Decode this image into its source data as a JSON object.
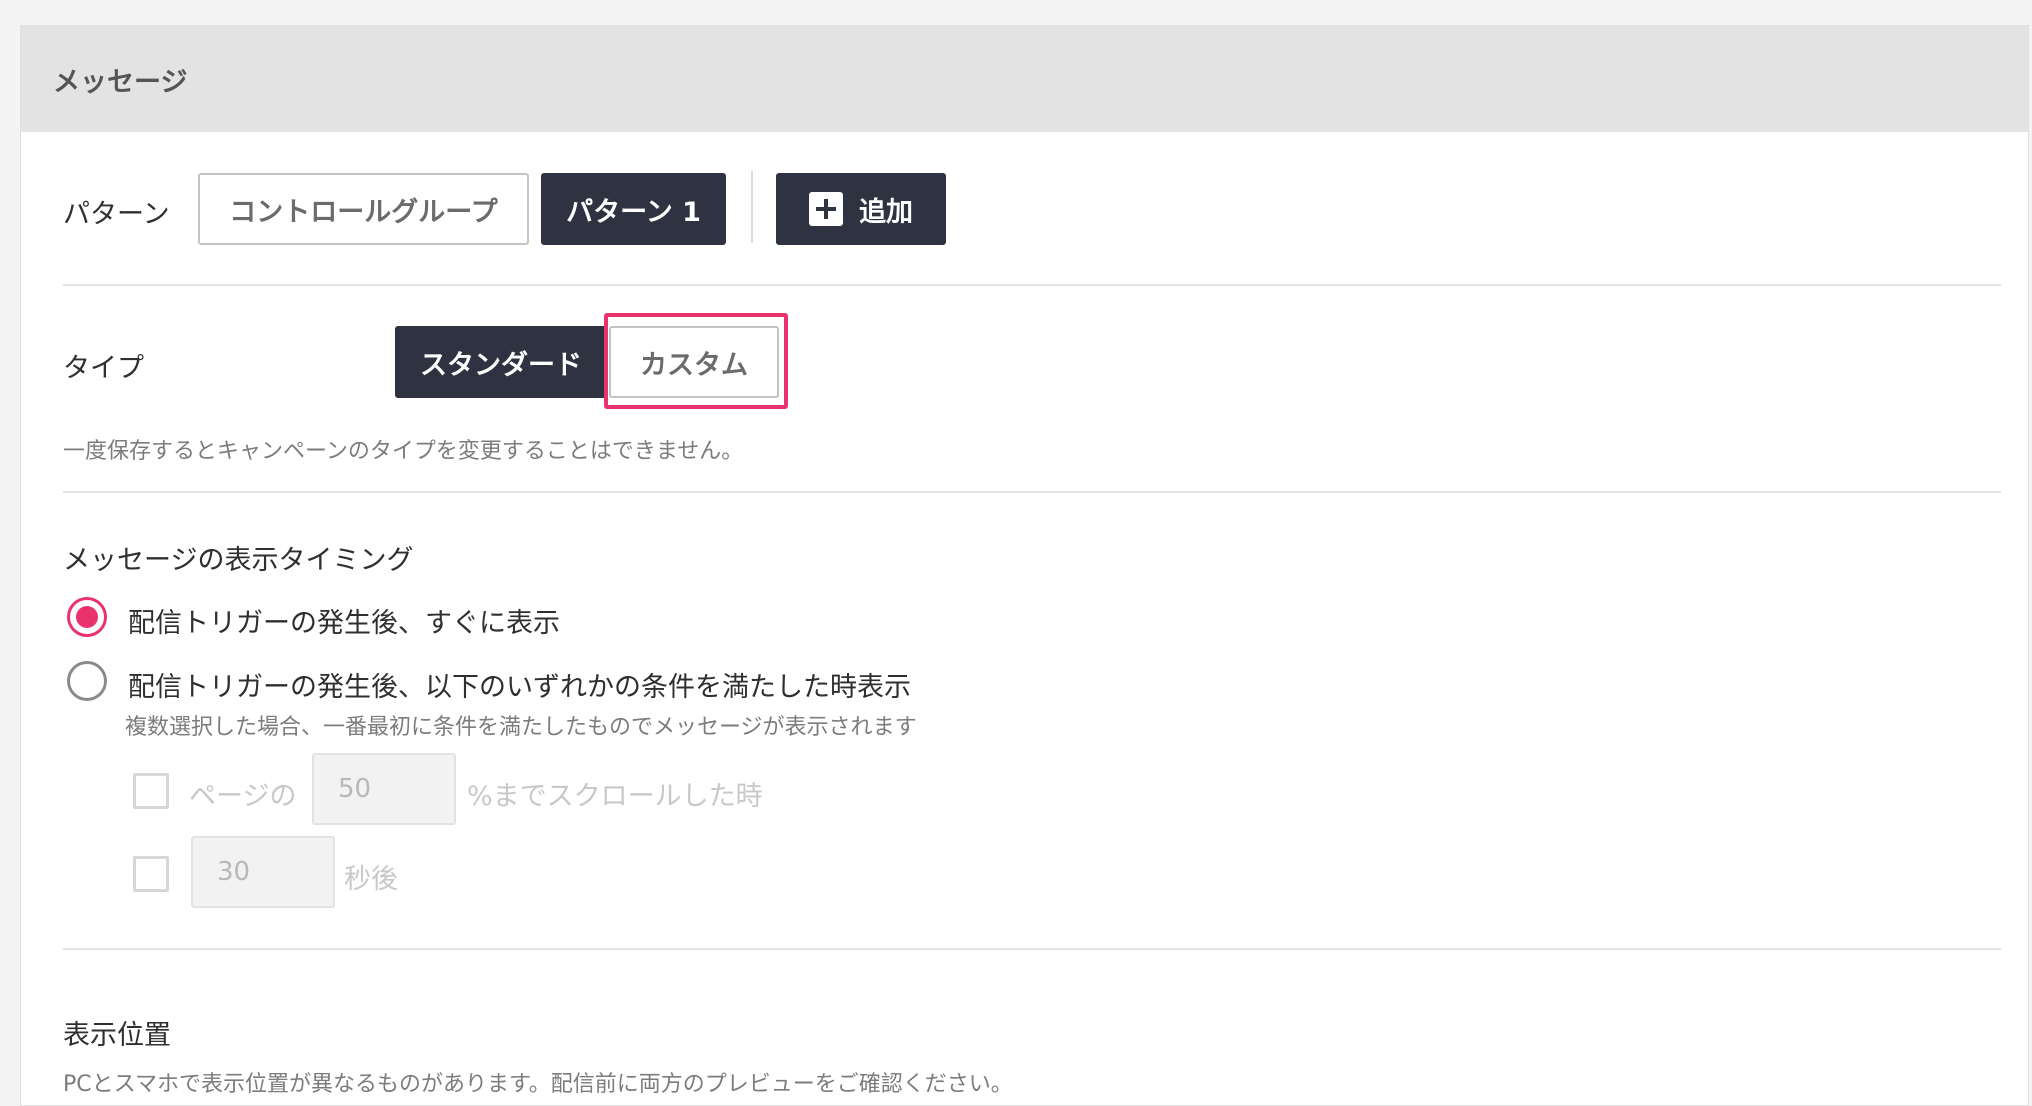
{
  "panel": {
    "title": "メッセージ"
  },
  "pattern": {
    "label": "パターン",
    "control_group": "コントロールグループ",
    "pattern1": "パターン 1",
    "add": "追加"
  },
  "type": {
    "label": "タイプ",
    "standard": "スタンダード",
    "custom": "カスタム",
    "note": "一度保存するとキャンペーンのタイプを変更することはできません。"
  },
  "timing": {
    "title": "メッセージの表示タイミング",
    "option_immediate": "配信トリガーの発生後、すぐに表示",
    "option_condition": "配信トリガーの発生後、以下のいずれかの条件を満たした時表示",
    "condition_note": "複数選択した場合、一番最初に条件を満たしたものでメッセージが表示されます",
    "scroll_prefix": "ページの",
    "scroll_value": "50",
    "scroll_suffix": "%までスクロールした時",
    "seconds_value": "30",
    "seconds_suffix": "秒後"
  },
  "position": {
    "title": "表示位置",
    "note": "PCとスマホで表示位置が異なるものがあります。配信前に両方のプレビューをご確認ください。"
  },
  "colors": {
    "accent": "#e8336d",
    "dark_button": "#2f3341",
    "header_bg": "#e3e3e3"
  },
  "icons": {
    "add": "plus-icon"
  }
}
